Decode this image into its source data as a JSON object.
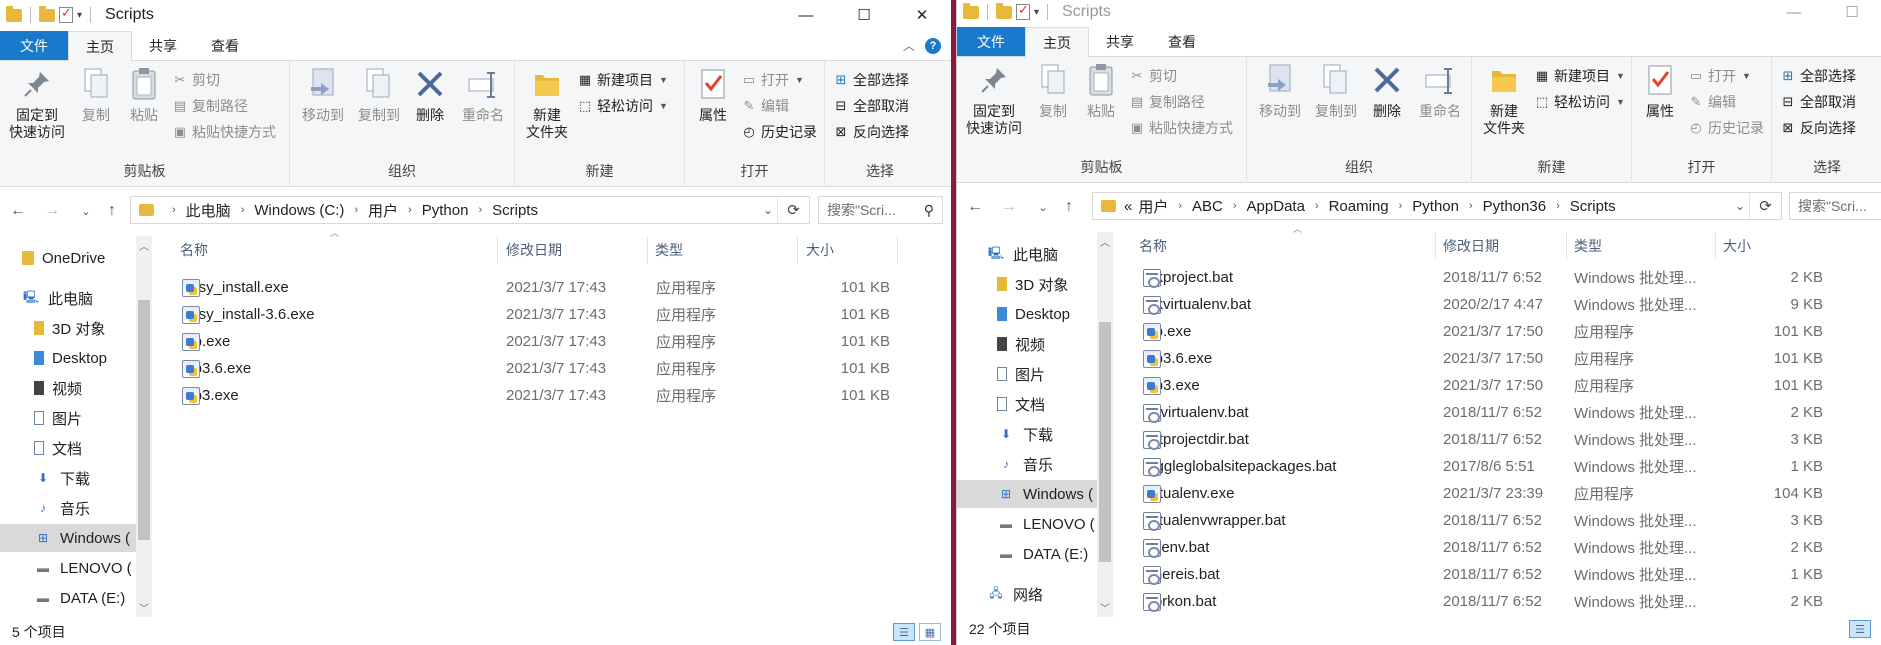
{
  "left": {
    "title": "Scripts",
    "tabs": [
      "文件",
      "主页",
      "共享",
      "查看"
    ],
    "ribbon": {
      "pin": "固定到\n快速访问",
      "copy": "复制",
      "paste": "粘贴",
      "cut": "剪切",
      "copy_path": "复制路径",
      "paste_shortcut": "粘贴快捷方式",
      "group_clipboard": "剪贴板",
      "move_to": "移动到",
      "copy_to": "复制到",
      "delete": "删除",
      "rename": "重命名",
      "group_organize": "组织",
      "new_folder": "新建\n文件夹",
      "new_item": "新建项目",
      "easy_access": "轻松访问",
      "group_new": "新建",
      "properties": "属性",
      "open": "打开",
      "edit": "编辑",
      "history": "历史记录",
      "group_open": "打开",
      "select_all": "全部选择",
      "select_none": "全部取消",
      "invert_selection": "反向选择",
      "group_select": "选择"
    },
    "breadcrumb": [
      "此电脑",
      "Windows (C:)",
      "用户",
      "Python",
      "Scripts"
    ],
    "search_placeholder": "搜索\"Scri...",
    "nav": [
      "OneDrive",
      "此电脑",
      "3D 对象",
      "Desktop",
      "视频",
      "图片",
      "文档",
      "下载",
      "音乐",
      "Windows (",
      "LENOVO (",
      "DATA (E:)"
    ],
    "columns": [
      "名称",
      "修改日期",
      "类型",
      "大小"
    ],
    "files": [
      {
        "name": "easy_install.exe",
        "date": "2021/3/7 17:43",
        "type": "应用程序",
        "size": "101 KB",
        "icon": "exe-icon"
      },
      {
        "name": "easy_install-3.6.exe",
        "date": "2021/3/7 17:43",
        "type": "应用程序",
        "size": "101 KB",
        "icon": "exe-icon"
      },
      {
        "name": "pip.exe",
        "date": "2021/3/7 17:43",
        "type": "应用程序",
        "size": "101 KB",
        "icon": "exe-icon"
      },
      {
        "name": "pip3.6.exe",
        "date": "2021/3/7 17:43",
        "type": "应用程序",
        "size": "101 KB",
        "icon": "exe-icon"
      },
      {
        "name": "pip3.exe",
        "date": "2021/3/7 17:43",
        "type": "应用程序",
        "size": "101 KB",
        "icon": "exe-icon"
      }
    ],
    "status": "5 个项目"
  },
  "right": {
    "title": "Scripts",
    "tabs": [
      "文件",
      "主页",
      "共享",
      "查看"
    ],
    "ribbon": {
      "pin": "固定到\n快速访问",
      "copy": "复制",
      "paste": "粘贴",
      "cut": "剪切",
      "copy_path": "复制路径",
      "paste_shortcut": "粘贴快捷方式",
      "group_clipboard": "剪贴板",
      "move_to": "移动到",
      "copy_to": "复制到",
      "delete": "删除",
      "rename": "重命名",
      "group_organize": "组织",
      "new_folder": "新建\n文件夹",
      "new_item": "新建项目",
      "easy_access": "轻松访问",
      "group_new": "新建",
      "properties": "属性",
      "open": "打开",
      "edit": "编辑",
      "history": "历史记录",
      "group_open": "打开",
      "select_all": "全部选择",
      "select_none": "全部取消",
      "invert_selection": "反向选择",
      "group_select": "选择"
    },
    "breadcrumb_prefix": "«",
    "breadcrumb": [
      "用户",
      "ABC",
      "AppData",
      "Roaming",
      "Python",
      "Python36",
      "Scripts"
    ],
    "search_placeholder": "搜索\"Scri...",
    "nav": [
      "此电脑",
      "3D 对象",
      "Desktop",
      "视频",
      "图片",
      "文档",
      "下载",
      "音乐",
      "Windows (",
      "LENOVO (",
      "DATA (E:)",
      "网络"
    ],
    "columns": [
      "名称",
      "修改日期",
      "类型",
      "大小"
    ],
    "files": [
      {
        "name": "mkproject.bat",
        "date": "2018/11/7 6:52",
        "type": "Windows 批处理...",
        "size": "2 KB",
        "icon": "bat-icon"
      },
      {
        "name": "mkvirtualenv.bat",
        "date": "2020/2/17 4:47",
        "type": "Windows 批处理...",
        "size": "9 KB",
        "icon": "bat-icon"
      },
      {
        "name": "pip.exe",
        "date": "2021/3/7 17:50",
        "type": "应用程序",
        "size": "101 KB",
        "icon": "exe-icon"
      },
      {
        "name": "pip3.6.exe",
        "date": "2021/3/7 17:50",
        "type": "应用程序",
        "size": "101 KB",
        "icon": "exe-icon"
      },
      {
        "name": "pip3.exe",
        "date": "2021/3/7 17:50",
        "type": "应用程序",
        "size": "101 KB",
        "icon": "exe-icon"
      },
      {
        "name": "rmvirtualenv.bat",
        "date": "2018/11/7 6:52",
        "type": "Windows 批处理...",
        "size": "2 KB",
        "icon": "bat-icon"
      },
      {
        "name": "setprojectdir.bat",
        "date": "2018/11/7 6:52",
        "type": "Windows 批处理...",
        "size": "3 KB",
        "icon": "bat-icon"
      },
      {
        "name": "toggleglobalsitepackages.bat",
        "date": "2017/8/6 5:51",
        "type": "Windows 批处理...",
        "size": "1 KB",
        "icon": "bat-icon"
      },
      {
        "name": "virtualenv.exe",
        "date": "2021/3/7 23:39",
        "type": "应用程序",
        "size": "104 KB",
        "icon": "exe-icon"
      },
      {
        "name": "virtualenvwrapper.bat",
        "date": "2018/11/7 6:52",
        "type": "Windows 批处理...",
        "size": "3 KB",
        "icon": "bat-icon"
      },
      {
        "name": "vwenv.bat",
        "date": "2018/11/7 6:52",
        "type": "Windows 批处理...",
        "size": "2 KB",
        "icon": "bat-icon"
      },
      {
        "name": "whereis.bat",
        "date": "2018/11/7 6:52",
        "type": "Windows 批处理...",
        "size": "1 KB",
        "icon": "bat-icon"
      },
      {
        "name": "workon.bat",
        "date": "2018/11/7 6:52",
        "type": "Windows 批处理...",
        "size": "2 KB",
        "icon": "bat-icon"
      }
    ],
    "status": "22 个项目"
  },
  "colors": {
    "file_tab": "#1979ca",
    "divider": "#8a1b3c",
    "selected_nav": "#d9d9d9",
    "folder": "#e8b83a"
  }
}
